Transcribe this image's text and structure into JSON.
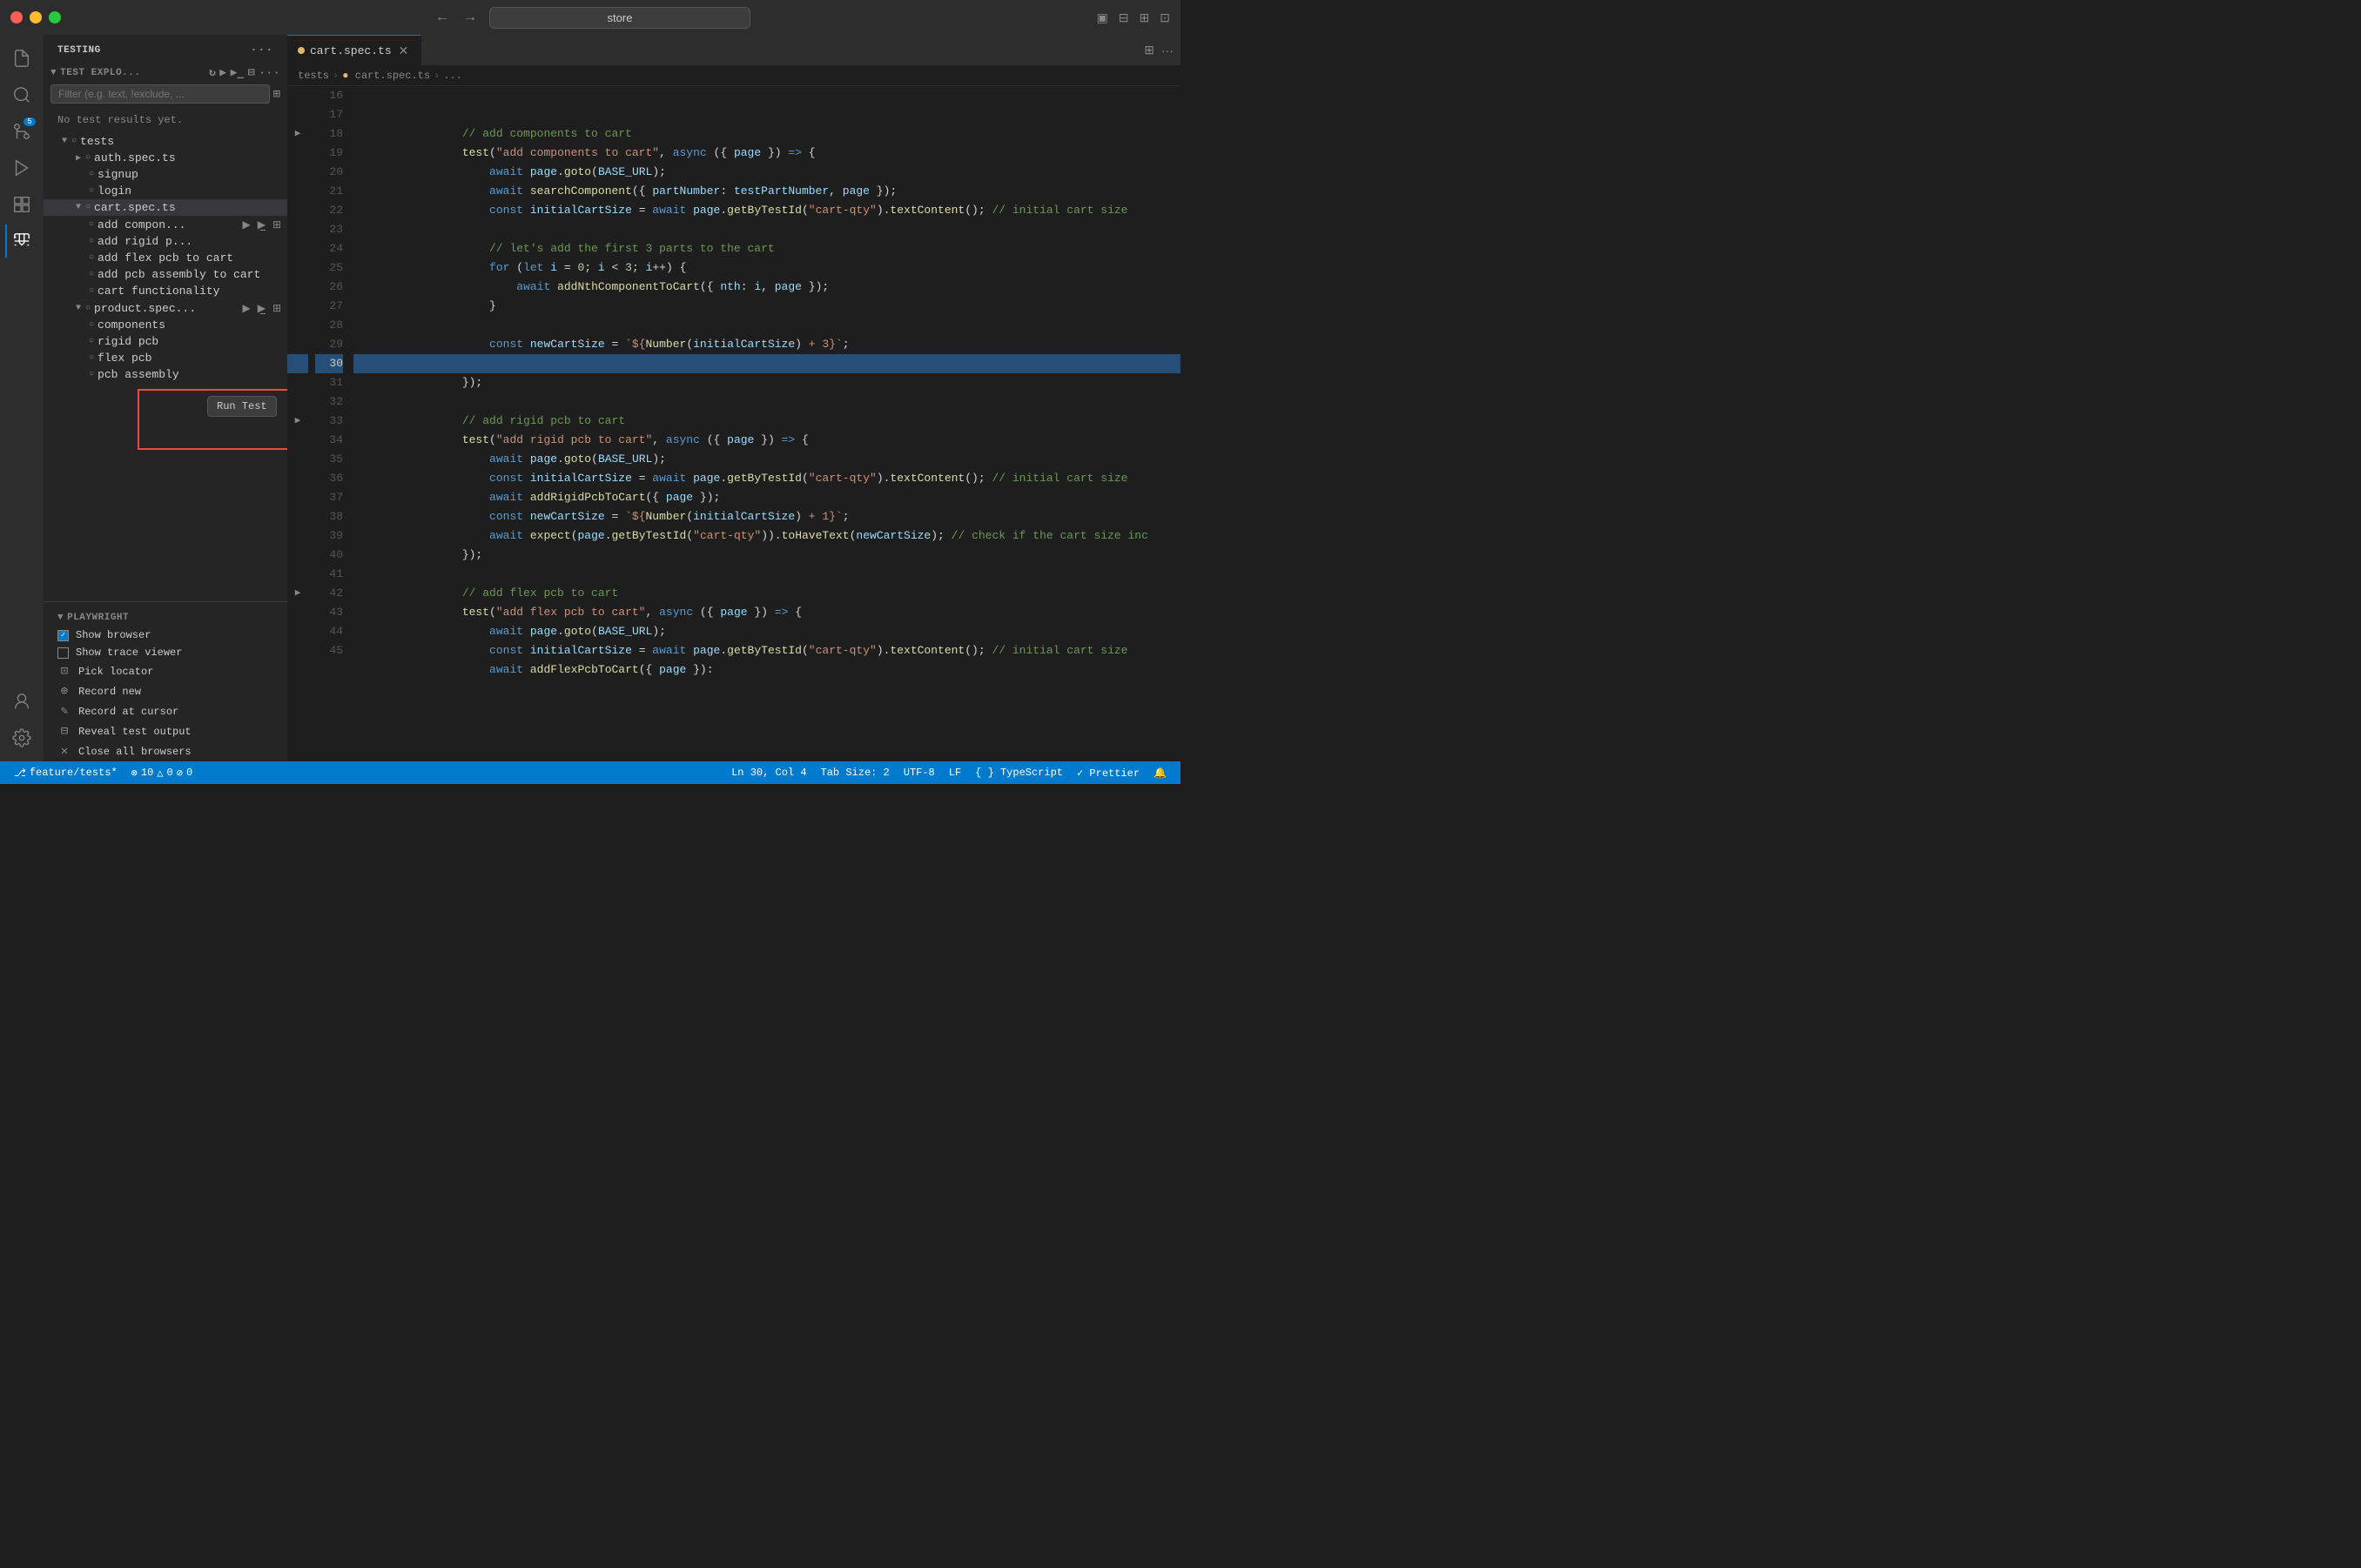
{
  "titlebar": {
    "search_placeholder": "store",
    "nav_back": "←",
    "nav_forward": "→"
  },
  "sidebar": {
    "header": "TESTING",
    "section": "TEST EXPLO...",
    "filter_placeholder": "Filter (e.g. text, !exclude, ...",
    "no_results": "No test results yet.",
    "tree": [
      {
        "label": "tests",
        "indent": 0,
        "type": "folder",
        "expanded": true
      },
      {
        "label": "auth.spec.ts",
        "indent": 1,
        "type": "file",
        "expanded": false
      },
      {
        "label": "signup",
        "indent": 2,
        "type": "test"
      },
      {
        "label": "login",
        "indent": 2,
        "type": "test"
      },
      {
        "label": "cart.spec.ts",
        "indent": 1,
        "type": "file",
        "expanded": true,
        "active": true
      },
      {
        "label": "add compon...",
        "indent": 2,
        "type": "test",
        "hasActions": true
      },
      {
        "label": "add rigid p...",
        "indent": 2,
        "type": "test"
      },
      {
        "label": "add flex pcb to cart",
        "indent": 2,
        "type": "test"
      },
      {
        "label": "add pcb assembly to cart",
        "indent": 2,
        "type": "test"
      },
      {
        "label": "cart functionality",
        "indent": 2,
        "type": "test"
      },
      {
        "label": "product.spec...",
        "indent": 1,
        "type": "file",
        "expanded": true
      },
      {
        "label": "components",
        "indent": 2,
        "type": "test"
      },
      {
        "label": "rigid pcb",
        "indent": 2,
        "type": "test"
      },
      {
        "label": "flex pcb",
        "indent": 2,
        "type": "test"
      },
      {
        "label": "pcb assembly",
        "indent": 2,
        "type": "test"
      }
    ],
    "playwright": {
      "title": "PLAYWRIGHT",
      "show_browser": "Show browser",
      "show_browser_checked": true,
      "show_trace": "Show trace viewer",
      "show_trace_checked": false,
      "pick_locator": "Pick locator",
      "record_new": "Record new",
      "record_at_cursor": "Record at cursor",
      "reveal_test_output": "Reveal test output",
      "close_browsers": "Close all browsers"
    }
  },
  "tab": {
    "label": "cart.spec.ts",
    "icon": "●"
  },
  "breadcrumb": {
    "parts": [
      "tests",
      "cart.spec.ts",
      "..."
    ]
  },
  "tooltip": {
    "run_test": "Run Test"
  },
  "status_bar": {
    "branch": "⎇  feature/tests*",
    "errors": "⊗ 10  △ 0  ⊘ 0",
    "cursor": "Ln 30, Col 4",
    "tab_size": "Tab Size: 2",
    "encoding": "UTF-8",
    "eol": "LF",
    "language": "{ } TypeScript",
    "prettier": "✓ Prettier",
    "bell": "🔔"
  }
}
